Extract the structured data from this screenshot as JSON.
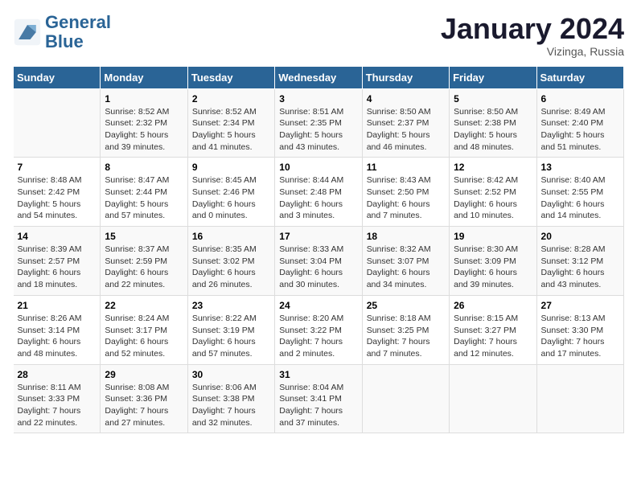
{
  "header": {
    "logo_general": "General",
    "logo_blue": "Blue",
    "month_title": "January 2024",
    "subtitle": "Vizinga, Russia"
  },
  "weekdays": [
    "Sunday",
    "Monday",
    "Tuesday",
    "Wednesday",
    "Thursday",
    "Friday",
    "Saturday"
  ],
  "weeks": [
    [
      {
        "day": "",
        "sunrise": "",
        "sunset": "",
        "daylight": ""
      },
      {
        "day": "1",
        "sunrise": "Sunrise: 8:52 AM",
        "sunset": "Sunset: 2:32 PM",
        "daylight": "Daylight: 5 hours and 39 minutes."
      },
      {
        "day": "2",
        "sunrise": "Sunrise: 8:52 AM",
        "sunset": "Sunset: 2:34 PM",
        "daylight": "Daylight: 5 hours and 41 minutes."
      },
      {
        "day": "3",
        "sunrise": "Sunrise: 8:51 AM",
        "sunset": "Sunset: 2:35 PM",
        "daylight": "Daylight: 5 hours and 43 minutes."
      },
      {
        "day": "4",
        "sunrise": "Sunrise: 8:50 AM",
        "sunset": "Sunset: 2:37 PM",
        "daylight": "Daylight: 5 hours and 46 minutes."
      },
      {
        "day": "5",
        "sunrise": "Sunrise: 8:50 AM",
        "sunset": "Sunset: 2:38 PM",
        "daylight": "Daylight: 5 hours and 48 minutes."
      },
      {
        "day": "6",
        "sunrise": "Sunrise: 8:49 AM",
        "sunset": "Sunset: 2:40 PM",
        "daylight": "Daylight: 5 hours and 51 minutes."
      }
    ],
    [
      {
        "day": "7",
        "sunrise": "Sunrise: 8:48 AM",
        "sunset": "Sunset: 2:42 PM",
        "daylight": "Daylight: 5 hours and 54 minutes."
      },
      {
        "day": "8",
        "sunrise": "Sunrise: 8:47 AM",
        "sunset": "Sunset: 2:44 PM",
        "daylight": "Daylight: 5 hours and 57 minutes."
      },
      {
        "day": "9",
        "sunrise": "Sunrise: 8:45 AM",
        "sunset": "Sunset: 2:46 PM",
        "daylight": "Daylight: 6 hours and 0 minutes."
      },
      {
        "day": "10",
        "sunrise": "Sunrise: 8:44 AM",
        "sunset": "Sunset: 2:48 PM",
        "daylight": "Daylight: 6 hours and 3 minutes."
      },
      {
        "day": "11",
        "sunrise": "Sunrise: 8:43 AM",
        "sunset": "Sunset: 2:50 PM",
        "daylight": "Daylight: 6 hours and 7 minutes."
      },
      {
        "day": "12",
        "sunrise": "Sunrise: 8:42 AM",
        "sunset": "Sunset: 2:52 PM",
        "daylight": "Daylight: 6 hours and 10 minutes."
      },
      {
        "day": "13",
        "sunrise": "Sunrise: 8:40 AM",
        "sunset": "Sunset: 2:55 PM",
        "daylight": "Daylight: 6 hours and 14 minutes."
      }
    ],
    [
      {
        "day": "14",
        "sunrise": "Sunrise: 8:39 AM",
        "sunset": "Sunset: 2:57 PM",
        "daylight": "Daylight: 6 hours and 18 minutes."
      },
      {
        "day": "15",
        "sunrise": "Sunrise: 8:37 AM",
        "sunset": "Sunset: 2:59 PM",
        "daylight": "Daylight: 6 hours and 22 minutes."
      },
      {
        "day": "16",
        "sunrise": "Sunrise: 8:35 AM",
        "sunset": "Sunset: 3:02 PM",
        "daylight": "Daylight: 6 hours and 26 minutes."
      },
      {
        "day": "17",
        "sunrise": "Sunrise: 8:33 AM",
        "sunset": "Sunset: 3:04 PM",
        "daylight": "Daylight: 6 hours and 30 minutes."
      },
      {
        "day": "18",
        "sunrise": "Sunrise: 8:32 AM",
        "sunset": "Sunset: 3:07 PM",
        "daylight": "Daylight: 6 hours and 34 minutes."
      },
      {
        "day": "19",
        "sunrise": "Sunrise: 8:30 AM",
        "sunset": "Sunset: 3:09 PM",
        "daylight": "Daylight: 6 hours and 39 minutes."
      },
      {
        "day": "20",
        "sunrise": "Sunrise: 8:28 AM",
        "sunset": "Sunset: 3:12 PM",
        "daylight": "Daylight: 6 hours and 43 minutes."
      }
    ],
    [
      {
        "day": "21",
        "sunrise": "Sunrise: 8:26 AM",
        "sunset": "Sunset: 3:14 PM",
        "daylight": "Daylight: 6 hours and 48 minutes."
      },
      {
        "day": "22",
        "sunrise": "Sunrise: 8:24 AM",
        "sunset": "Sunset: 3:17 PM",
        "daylight": "Daylight: 6 hours and 52 minutes."
      },
      {
        "day": "23",
        "sunrise": "Sunrise: 8:22 AM",
        "sunset": "Sunset: 3:19 PM",
        "daylight": "Daylight: 6 hours and 57 minutes."
      },
      {
        "day": "24",
        "sunrise": "Sunrise: 8:20 AM",
        "sunset": "Sunset: 3:22 PM",
        "daylight": "Daylight: 7 hours and 2 minutes."
      },
      {
        "day": "25",
        "sunrise": "Sunrise: 8:18 AM",
        "sunset": "Sunset: 3:25 PM",
        "daylight": "Daylight: 7 hours and 7 minutes."
      },
      {
        "day": "26",
        "sunrise": "Sunrise: 8:15 AM",
        "sunset": "Sunset: 3:27 PM",
        "daylight": "Daylight: 7 hours and 12 minutes."
      },
      {
        "day": "27",
        "sunrise": "Sunrise: 8:13 AM",
        "sunset": "Sunset: 3:30 PM",
        "daylight": "Daylight: 7 hours and 17 minutes."
      }
    ],
    [
      {
        "day": "28",
        "sunrise": "Sunrise: 8:11 AM",
        "sunset": "Sunset: 3:33 PM",
        "daylight": "Daylight: 7 hours and 22 minutes."
      },
      {
        "day": "29",
        "sunrise": "Sunrise: 8:08 AM",
        "sunset": "Sunset: 3:36 PM",
        "daylight": "Daylight: 7 hours and 27 minutes."
      },
      {
        "day": "30",
        "sunrise": "Sunrise: 8:06 AM",
        "sunset": "Sunset: 3:38 PM",
        "daylight": "Daylight: 7 hours and 32 minutes."
      },
      {
        "day": "31",
        "sunrise": "Sunrise: 8:04 AM",
        "sunset": "Sunset: 3:41 PM",
        "daylight": "Daylight: 7 hours and 37 minutes."
      },
      {
        "day": "",
        "sunrise": "",
        "sunset": "",
        "daylight": ""
      },
      {
        "day": "",
        "sunrise": "",
        "sunset": "",
        "daylight": ""
      },
      {
        "day": "",
        "sunrise": "",
        "sunset": "",
        "daylight": ""
      }
    ]
  ]
}
